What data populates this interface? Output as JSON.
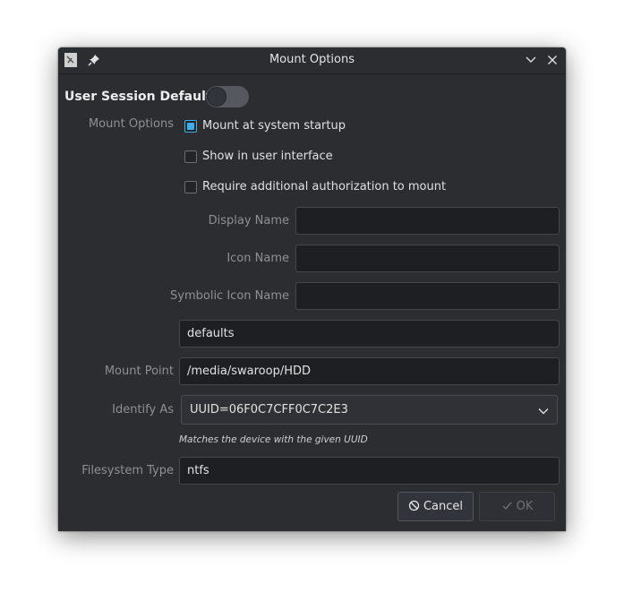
{
  "window": {
    "title": "Mount Options",
    "icons": [
      "app-icon",
      "pin-icon",
      "chevron-down-icon",
      "close-icon"
    ]
  },
  "session": {
    "label": "User Session Defaults",
    "toggle_on": false
  },
  "mount_options": {
    "label": "Mount Options",
    "checkboxes": [
      {
        "label": "Mount at system startup",
        "checked": true
      },
      {
        "label": "Show in user interface",
        "checked": false
      },
      {
        "label": "Require additional authorization to mount",
        "checked": false
      }
    ]
  },
  "fields": {
    "display_name": {
      "label": "Display Name",
      "value": ""
    },
    "icon_name": {
      "label": "Icon Name",
      "value": ""
    },
    "symbolic_icon_name": {
      "label": "Symbolic Icon Name",
      "value": ""
    },
    "options_value": "defaults",
    "mount_point": {
      "label": "Mount Point",
      "value": "/media/swaroop/HDD"
    },
    "identify_as": {
      "label": "Identify As",
      "value": "UUID=06F0C7CFF0C7C2E3",
      "hint": "Matches the device with the given UUID"
    },
    "filesystem_type": {
      "label": "Filesystem Type",
      "value": "ntfs"
    }
  },
  "buttons": {
    "cancel": "Cancel",
    "ok": "OK"
  },
  "colors": {
    "accent": "#3daee9",
    "background": "#2b2d31",
    "field": "#1e1f22"
  }
}
